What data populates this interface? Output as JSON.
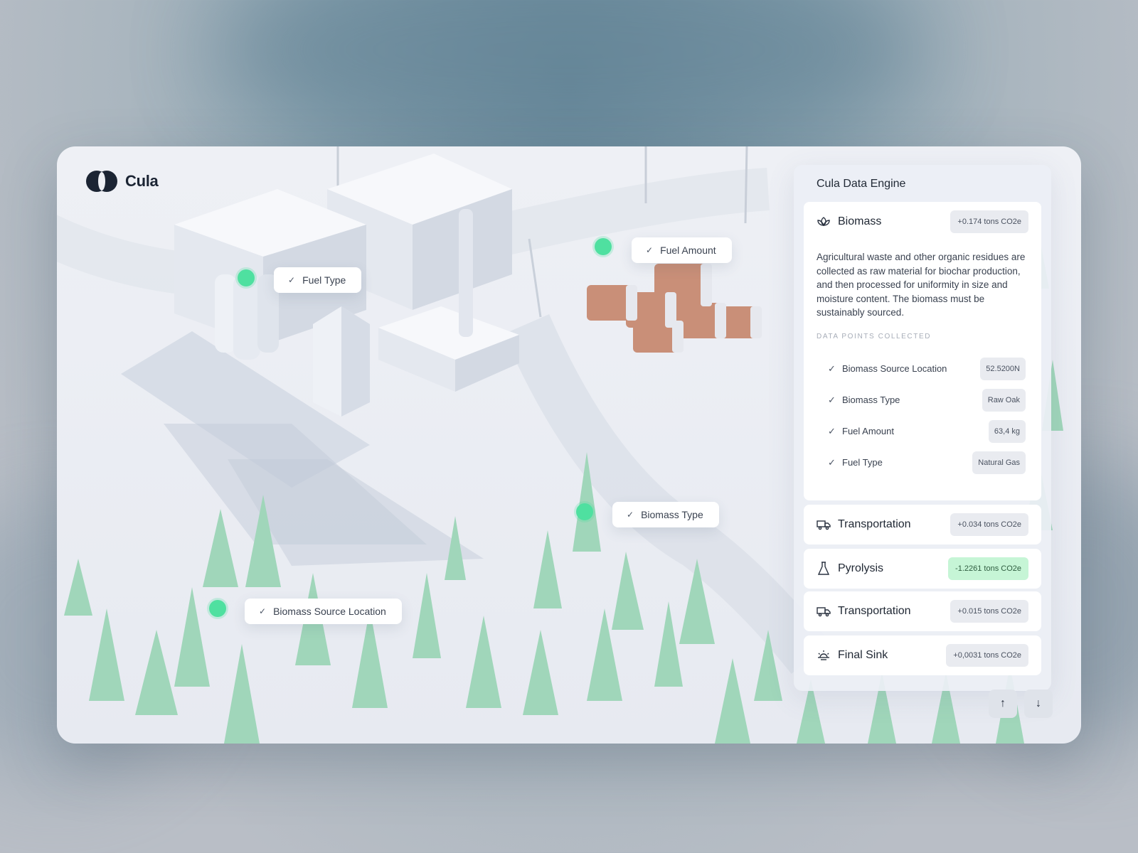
{
  "app": {
    "name": "Cula"
  },
  "scene_tags": [
    {
      "label": "Fuel Type"
    },
    {
      "label": "Fuel Amount"
    },
    {
      "label": "Biomass Type"
    },
    {
      "label": "Biomass Source Location"
    }
  ],
  "panel": {
    "title": "Cula Data Engine",
    "biomass": {
      "name": "Biomass",
      "icon": "lotus-icon",
      "badge": "+0.174 tons CO2e",
      "description": "Agricultural waste and other organic residues are collected as raw material for biochar production, and then processed for uniformity in size and moisture content. The biomass must be sustainably sourced.",
      "data_points_title": "DATA POINTS COLLECTED",
      "data_points": [
        {
          "label": "Biomass Source Location",
          "value": "52.5200N"
        },
        {
          "label": "Biomass Type",
          "value": "Raw Oak"
        },
        {
          "label": "Fuel Amount",
          "value": "63,4 kg"
        },
        {
          "label": "Fuel Type",
          "value": "Natural Gas"
        }
      ]
    },
    "stages": [
      {
        "name": "Transportation",
        "icon": "truck-icon",
        "badge": "+0.034 tons CO2e",
        "accent": "#e9ebf0"
      },
      {
        "name": "Pyrolysis",
        "icon": "flask-icon",
        "badge": "-1.2261 tons CO2e",
        "accent": "#c6f5d6"
      },
      {
        "name": "Transportation",
        "icon": "truck-icon",
        "badge": "+0.015 tons CO2e",
        "accent": "#e9ebf0"
      },
      {
        "name": "Final Sink",
        "icon": "sunrise-icon",
        "badge": "+0,0031 tons CO2e",
        "accent": "#e9ebf0"
      }
    ]
  },
  "colors": {
    "marker": "#4fe0a0",
    "tree": "#9fd3b6",
    "logs": "#c98f78"
  }
}
